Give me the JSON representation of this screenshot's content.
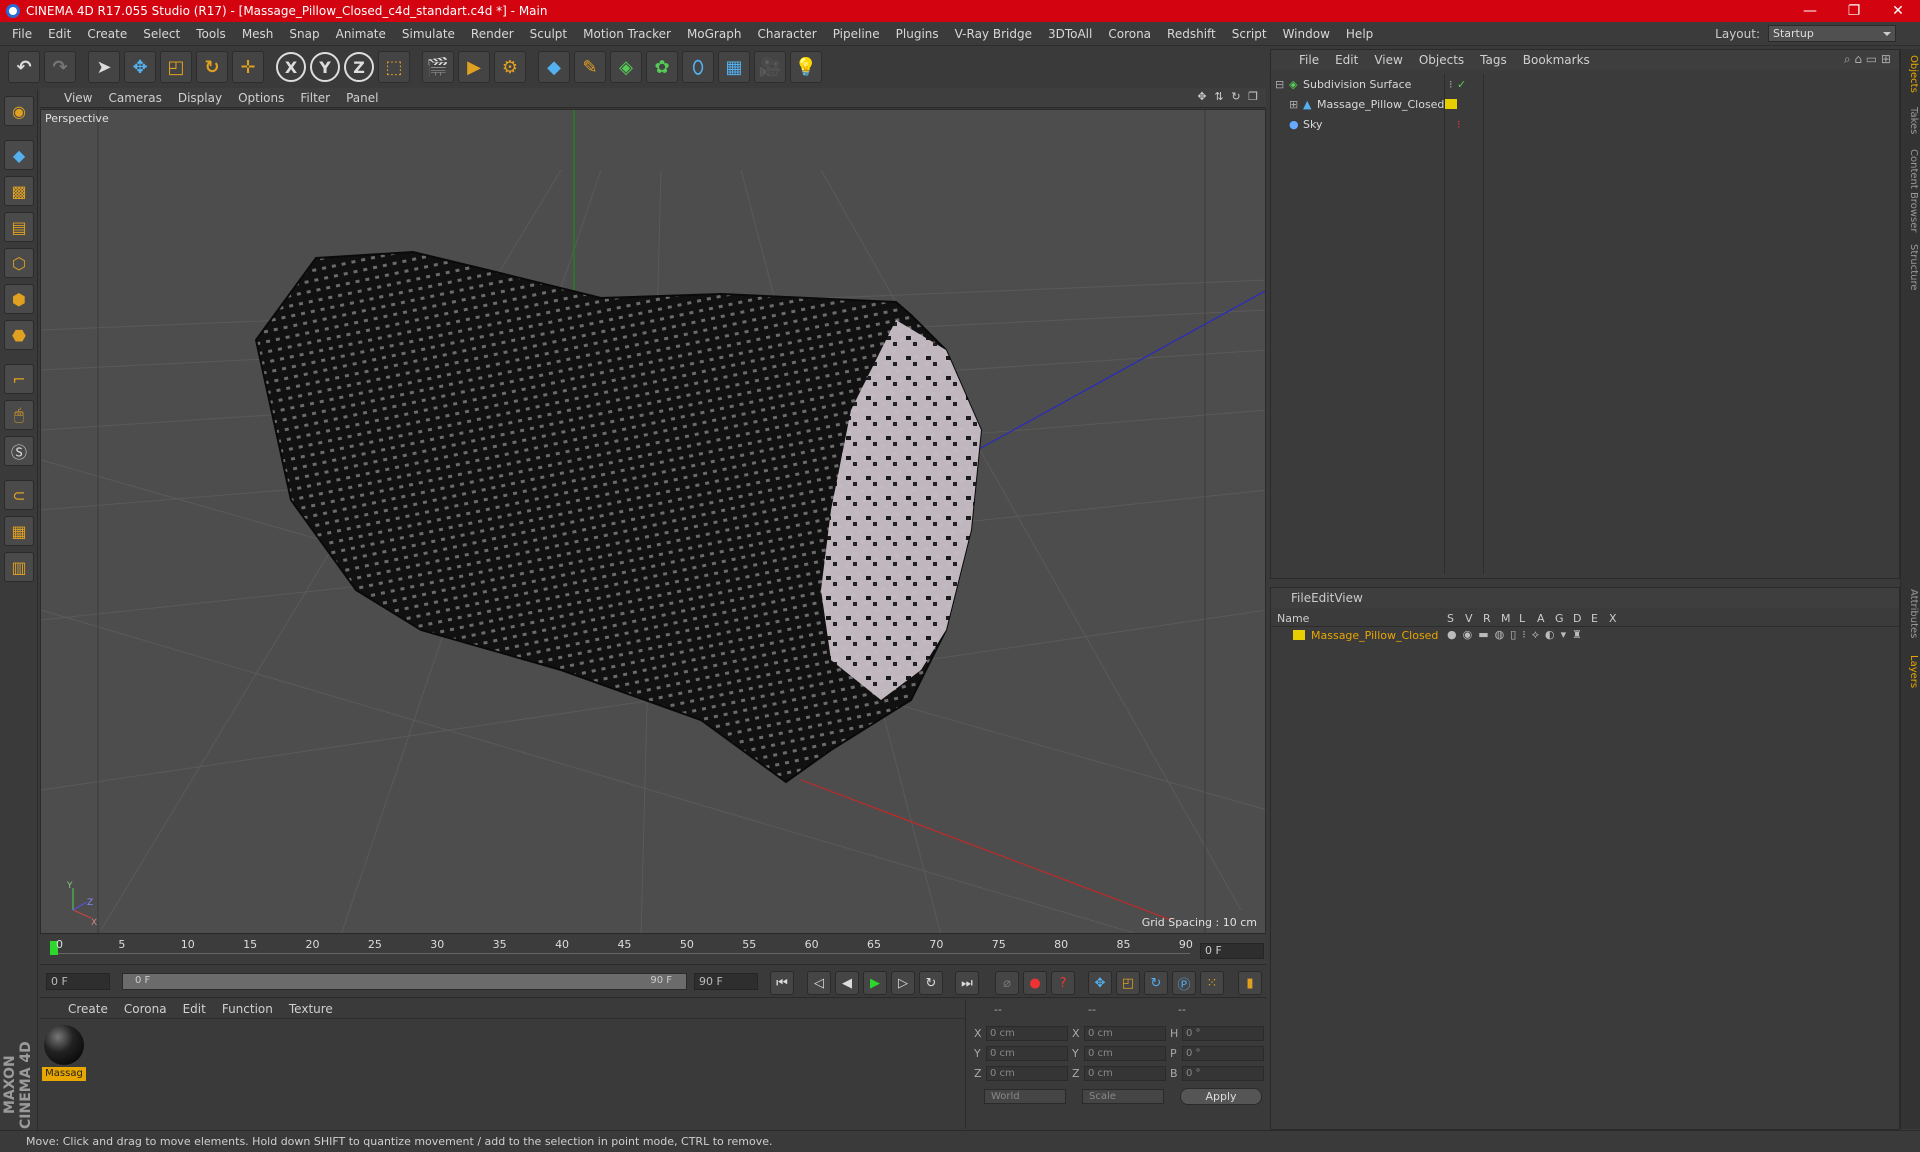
{
  "titlebar": {
    "title": "CINEMA 4D R17.055 Studio (R17) - [Massage_Pillow_Closed_c4d_standart.c4d *] - Main",
    "min": "—",
    "max": "❐",
    "close": "✕"
  },
  "menubar": [
    "File",
    "Edit",
    "Create",
    "Select",
    "Tools",
    "Mesh",
    "Snap",
    "Animate",
    "Simulate",
    "Render",
    "Sculpt",
    "Motion Tracker",
    "MoGraph",
    "Character",
    "Pipeline",
    "Plugins",
    "V-Ray Bridge",
    "3DToAll",
    "Corona",
    "Redshift",
    "Script",
    "Window",
    "Help"
  ],
  "layout": {
    "label": "Layout:",
    "value": "Startup"
  },
  "toolbar": {
    "axis_x": "X",
    "axis_y": "Y",
    "axis_z": "Z"
  },
  "viewport": {
    "menu": [
      "View",
      "Cameras",
      "Display",
      "Options",
      "Filter",
      "Panel"
    ],
    "label": "Perspective",
    "grid_spacing": "Grid Spacing : 10 cm",
    "axis_x": "X",
    "axis_y": "Y",
    "axis_z": "Z"
  },
  "timeline": {
    "ticks": [
      "0",
      "5",
      "10",
      "15",
      "20",
      "25",
      "30",
      "35",
      "40",
      "45",
      "50",
      "55",
      "60",
      "65",
      "70",
      "75",
      "80",
      "85",
      "90"
    ],
    "current": "0 F"
  },
  "transport": {
    "start": "0 F",
    "range_start": "0 F",
    "range_end": "90 F",
    "end": "90 F"
  },
  "material": {
    "menu": [
      "Create",
      "Corona",
      "Edit",
      "Function",
      "Texture"
    ],
    "name": "Massag"
  },
  "coords": {
    "header": [
      "--",
      "--",
      "--"
    ],
    "rows": [
      {
        "l1": "X",
        "v1": "0 cm",
        "l2": "X",
        "v2": "0 cm",
        "l3": "H",
        "v3": "0 °"
      },
      {
        "l1": "Y",
        "v1": "0 cm",
        "l2": "Y",
        "v2": "0 cm",
        "l3": "P",
        "v3": "0 °"
      },
      {
        "l1": "Z",
        "v1": "0 cm",
        "l2": "Z",
        "v2": "0 cm",
        "l3": "B",
        "v3": "0 °"
      }
    ],
    "mode": "World",
    "type": "Scale",
    "apply": "Apply"
  },
  "objects": {
    "menu": [
      "File",
      "Edit",
      "View",
      "Objects",
      "Tags",
      "Bookmarks"
    ],
    "items": [
      {
        "name": "Subdivision Surface"
      },
      {
        "name": "Massage_Pillow_Closed"
      },
      {
        "name": "Sky"
      }
    ]
  },
  "layers": {
    "menu": [
      "File",
      "Edit",
      "View"
    ],
    "header": {
      "name": "Name",
      "cols": [
        "S",
        "V",
        "R",
        "M",
        "L",
        "A",
        "G",
        "D",
        "E",
        "X"
      ]
    },
    "item": "Massage_Pillow_Closed"
  },
  "sidetabs": [
    "Objects",
    "Takes",
    "Content Browser",
    "Structure",
    "Attributes",
    "Layers"
  ],
  "maxon": "MAXON CINEMA 4D",
  "status": "Move: Click and drag to move elements. Hold down SHIFT to quantize movement / add to the selection in point mode, CTRL to remove.",
  "colors": {
    "title_bar": "#d3030f",
    "accent": "#e8a600",
    "layer_swatch": "#e8d000"
  }
}
